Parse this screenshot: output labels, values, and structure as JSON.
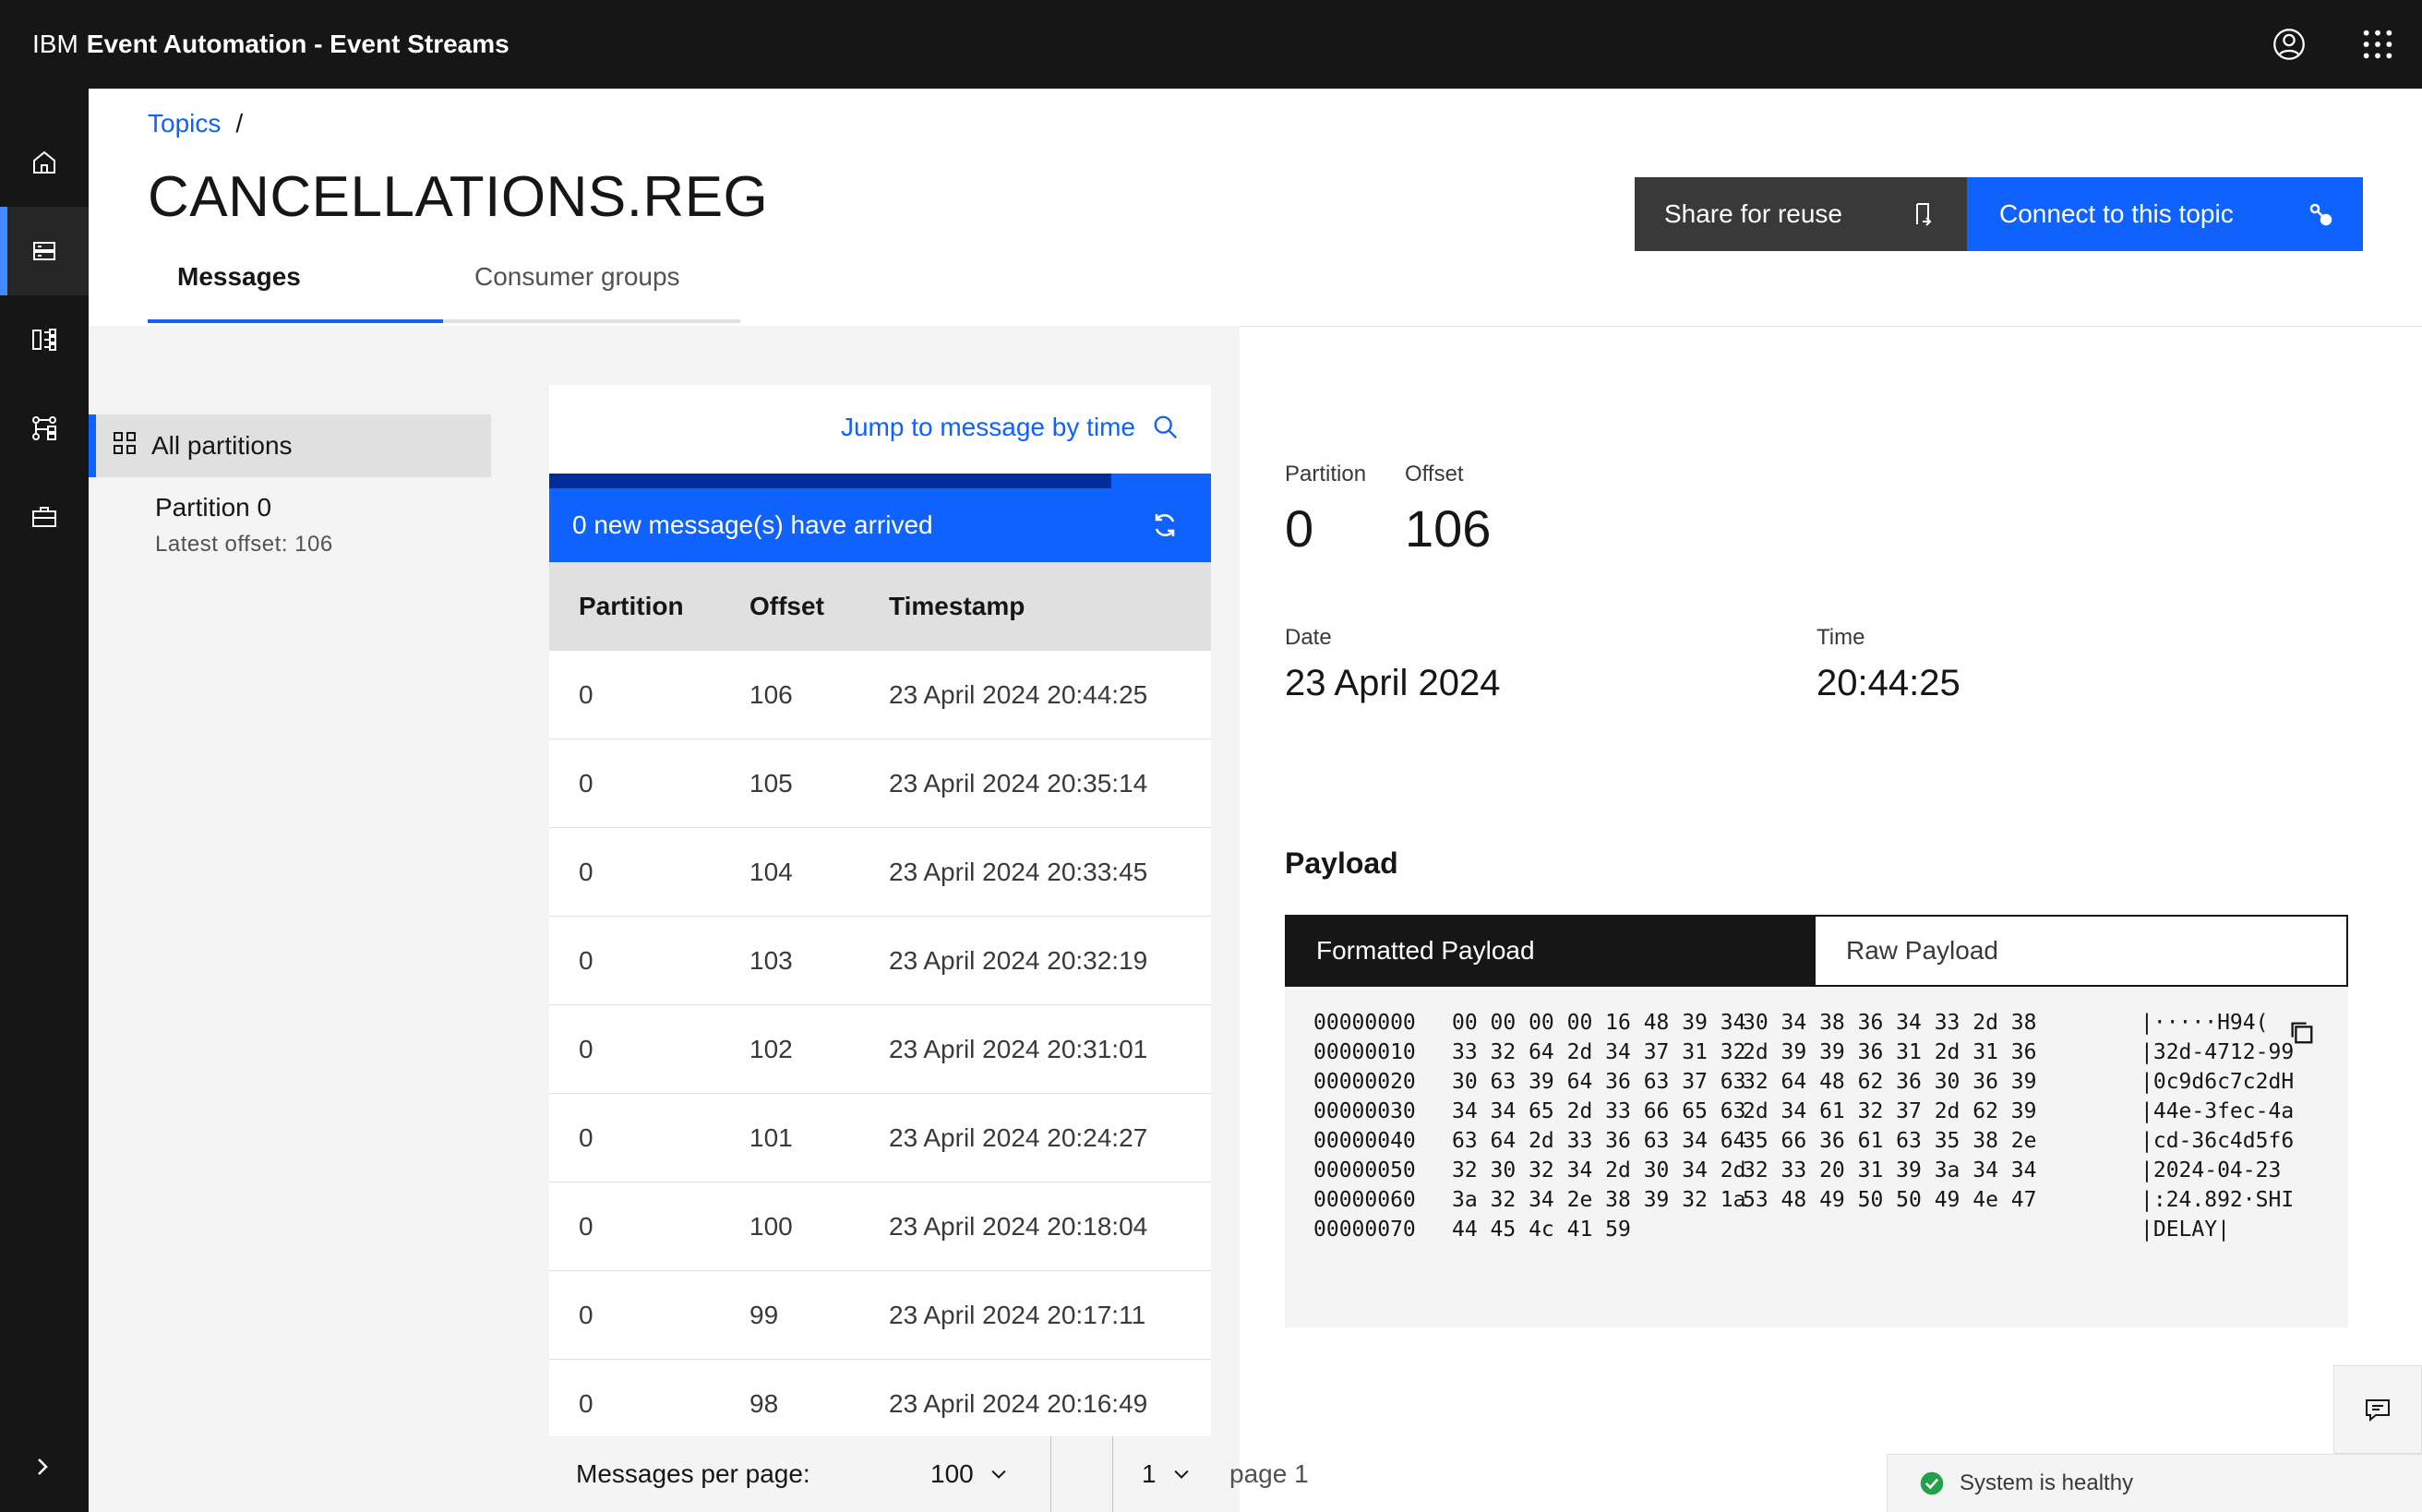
{
  "header": {
    "brand_ibm": "IBM",
    "brand_product": "Event Automation - Event Streams",
    "user_icon": "user-avatar-icon",
    "switcher_icon": "app-switcher-icon"
  },
  "sidenav": {
    "items": [
      {
        "icon": "home-icon",
        "active": false
      },
      {
        "icon": "topics-icon",
        "active": true
      },
      {
        "icon": "consumer-groups-icon",
        "active": false
      },
      {
        "icon": "schema-registry-icon",
        "active": false
      },
      {
        "icon": "toolbox-icon",
        "active": false
      }
    ],
    "expand_icon": "chevron-right-icon"
  },
  "breadcrumb": {
    "link": "Topics",
    "separator": "/"
  },
  "page": {
    "title": "CANCELLATIONS.REG",
    "share_button": "Share for reuse",
    "connect_button": "Connect to this topic"
  },
  "tabs": [
    {
      "label": "Messages",
      "active": true
    },
    {
      "label": "Consumer groups",
      "active": false
    }
  ],
  "partitions": {
    "all_label": "All partitions",
    "items": [
      {
        "name": "Partition 0",
        "latest": "Latest offset: 106"
      }
    ]
  },
  "messages": {
    "jump_link": "Jump to message by time",
    "banner": "0 new message(s) have arrived",
    "columns": [
      "Partition",
      "Offset",
      "Timestamp"
    ],
    "rows": [
      [
        "0",
        "106",
        "23 April 2024 20:44:25"
      ],
      [
        "0",
        "105",
        "23 April 2024 20:35:14"
      ],
      [
        "0",
        "104",
        "23 April 2024 20:33:45"
      ],
      [
        "0",
        "103",
        "23 April 2024 20:32:19"
      ],
      [
        "0",
        "102",
        "23 April 2024 20:31:01"
      ],
      [
        "0",
        "101",
        "23 April 2024 20:24:27"
      ],
      [
        "0",
        "100",
        "23 April 2024 20:18:04"
      ],
      [
        "0",
        "99",
        "23 April 2024 20:17:11"
      ],
      [
        "0",
        "98",
        "23 April 2024 20:16:49"
      ]
    ],
    "progress": 0.85
  },
  "pagination": {
    "per_page_label": "Messages per page:",
    "per_page_value": "100",
    "page_value": "1",
    "page_label": "page 1"
  },
  "detail": {
    "partition_label": "Partition",
    "partition_value": "0",
    "offset_label": "Offset",
    "offset_value": "106",
    "date_label": "Date",
    "date_value": "23 April 2024",
    "time_label": "Time",
    "time_value": "20:44:25",
    "payload_title": "Payload",
    "payload_tabs": [
      "Formatted Payload",
      "Raw Payload"
    ],
    "hex_lines": [
      {
        "offset": "00000000",
        "b1": "00 00 00 00 16 48 39 34",
        "b2": "30 34 38 36 34 33 2d 38",
        "ascii": "|·····H94("
      },
      {
        "offset": "00000010",
        "b1": "33 32 64 2d 34 37 31 32",
        "b2": "2d 39 39 36 31 2d 31 36",
        "ascii": "|32d-4712-99"
      },
      {
        "offset": "00000020",
        "b1": "30 63 39 64 36 63 37 63",
        "b2": "32 64 48 62 36 30 36 39",
        "ascii": "|0c9d6c7c2dH"
      },
      {
        "offset": "00000030",
        "b1": "34 34 65 2d 33 66 65 63",
        "b2": "2d 34 61 32 37 2d 62 39",
        "ascii": "|44e-3fec-4a"
      },
      {
        "offset": "00000040",
        "b1": "63 64 2d 33 36 63 34 64",
        "b2": "35 66 36 61 63 35 38 2e",
        "ascii": "|cd-36c4d5f6"
      },
      {
        "offset": "00000050",
        "b1": "32 30 32 34 2d 30 34 2d",
        "b2": "32 33 20 31 39 3a 34 34",
        "ascii": "|2024-04-23"
      },
      {
        "offset": "00000060",
        "b1": "3a 32 34 2e 38 39 32 1a",
        "b2": "53 48 49 50 50 49 4e 47",
        "ascii": "|:24.892·SHI"
      },
      {
        "offset": "00000070",
        "b1": "44 45 4c 41 59",
        "b2": "",
        "ascii": "|DELAY|"
      }
    ]
  },
  "status": {
    "health_text": "System is healthy",
    "health_color": "#24a148",
    "feedback_icon": "chat-feedback-icon"
  },
  "colors": {
    "primary": "#0f62fe",
    "header_bg": "#161616"
  }
}
